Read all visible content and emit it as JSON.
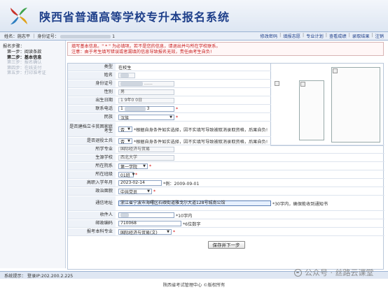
{
  "header": {
    "title": "陕西省普通高等学校专升本报名系统"
  },
  "topbar": {
    "name_label": "姓名：",
    "name_value": "施志平",
    "id_label": "｜ 身份证号：",
    "id_tail": "1",
    "nav": [
      "修改密码",
      "填报志愿",
      "专业计划",
      "查看成绩",
      "录取结果",
      "注销"
    ]
  },
  "sidebar": {
    "heading": "报名步骤：",
    "steps": [
      {
        "label": "第一步：阅读条款",
        "state": "done"
      },
      {
        "label": "第二步：基本信息",
        "state": "current"
      },
      {
        "label": "第三步：报名确认",
        "state": "pending"
      },
      {
        "label": "第四步：在线支付",
        "state": "pending"
      },
      {
        "label": "第五步：打印准考证",
        "state": "pending"
      }
    ]
  },
  "notice": {
    "line1": "填写基本信息。\" * \" 为必填项。若不是您的信息，请退出并与所在学校联系。",
    "line2": "注意：由于考生填写错误或者漏填的信息导致报名无效，责任由考生自负!"
  },
  "form": {
    "fields": [
      {
        "label": "类型",
        "value": "在校生"
      },
      {
        "label": "姓名",
        "value": ""
      },
      {
        "label": "身份证号",
        "value": "",
        "tail": "……"
      },
      {
        "label": "性别",
        "value": "男"
      },
      {
        "label": "出生日期",
        "value": "1  9年0   0日"
      },
      {
        "label": "联系电话",
        "value": "1",
        "tail": "3"
      },
      {
        "label": "民族",
        "value": "汉族"
      },
      {
        "label": "是否建档立卡贫困家庭考生",
        "value": "否",
        "hint": "*根据自身条件如实选择，因不实填写导致被取消录取资格，后果自负!"
      },
      {
        "label": "是否退役士兵",
        "value": "否",
        "hint": "*根据自身条件如实选择，因不实填写导致被取消录取资格，后果自负!"
      },
      {
        "label": "所学专业",
        "value": "国际经济与贸易"
      },
      {
        "label": "生源学校",
        "value": "西北大学"
      },
      {
        "label": "所在院系",
        "value": "第一学院"
      },
      {
        "label": "所在班级",
        "value": "01班"
      },
      {
        "label": "高职入学年月",
        "value": "2023-02-14",
        "hint": "*例：2009-09-01"
      },
      {
        "label": "政治面貌",
        "value": "中共党员"
      },
      {
        "label": "通信地址",
        "value": "浙江省宁波市海曙区石碶街道雅戈尔大道128号城南公馆",
        "hint": "*30字内，确保能收到通知书"
      },
      {
        "label": "收件人",
        "value": "",
        "hint": "*10字内"
      },
      {
        "label": "邮政编码",
        "value": "710068",
        "hint": "*6位数字"
      },
      {
        "label": "报考本科专业",
        "value": "国际经济与贸易(文)"
      }
    ],
    "submit_label": "保存并下一步"
  },
  "footer": {
    "status": "系统提示：  登录IP:202.200.2.225",
    "copyright": "陕西省考试管理中心 ©版权所有",
    "watermark": "公众号 · 丝路云课堂"
  },
  "colors": {
    "title_blue": "#1e3f8a",
    "required_red": "#d40000",
    "notice_red": "#c81e1e"
  }
}
